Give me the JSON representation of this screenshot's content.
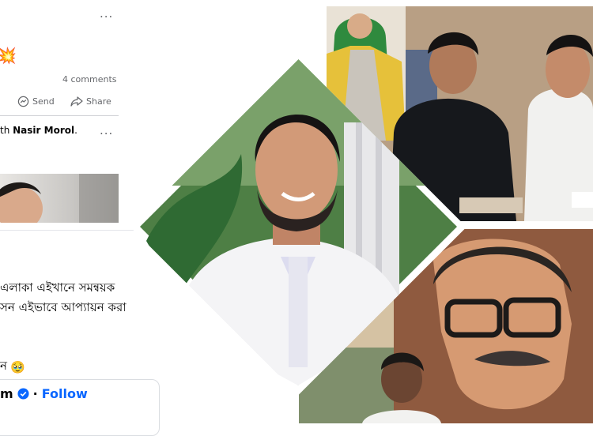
{
  "post": {
    "more_icon": "...",
    "comments": "4 comments",
    "send_label": "Send",
    "share_label": "Share",
    "tagged_prefix": "th",
    "tagged_name": "Nasir Morol",
    "text_line1": "এলাকা এইখানে সমন্বয়ক",
    "text_line2": "সন এইভাবে আপ্যায়ন করা",
    "text_line3": "ন",
    "emoji_face": "🥹",
    "emoji_boom": "💥",
    "account_tail": "m",
    "follow_label": "Follow",
    "verified_color": "#0866ff"
  }
}
